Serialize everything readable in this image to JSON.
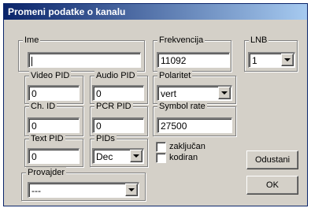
{
  "window": {
    "title": "Promeni podatke o kanalu"
  },
  "fields": {
    "ime": {
      "label": "Ime",
      "value": ""
    },
    "frekvencija": {
      "label": "Frekvencija",
      "value": "11092"
    },
    "lnb": {
      "label": "LNB",
      "value": "1"
    },
    "video_pid": {
      "label": "Video PID",
      "value": "0"
    },
    "audio_pid": {
      "label": "Audio PID",
      "value": "0"
    },
    "polaritet": {
      "label": "Polaritet",
      "value": "vert"
    },
    "ch_id": {
      "label": "Ch. ID",
      "value": "0"
    },
    "pcr_pid": {
      "label": "PCR PID",
      "value": "0"
    },
    "symbol_rate": {
      "label": "Symbol rate",
      "value": "27500"
    },
    "text_pid": {
      "label": "Text PID",
      "value": "0"
    },
    "pids": {
      "label": "PIDs",
      "value": "Dec"
    },
    "provajder": {
      "label": "Provajder",
      "value": "---"
    }
  },
  "checkboxes": {
    "zakljucan": {
      "label": "zaključan",
      "checked": false
    },
    "kodiran": {
      "label": "kodiran",
      "checked": false
    }
  },
  "buttons": {
    "cancel": "Odustani",
    "ok": "OK"
  }
}
